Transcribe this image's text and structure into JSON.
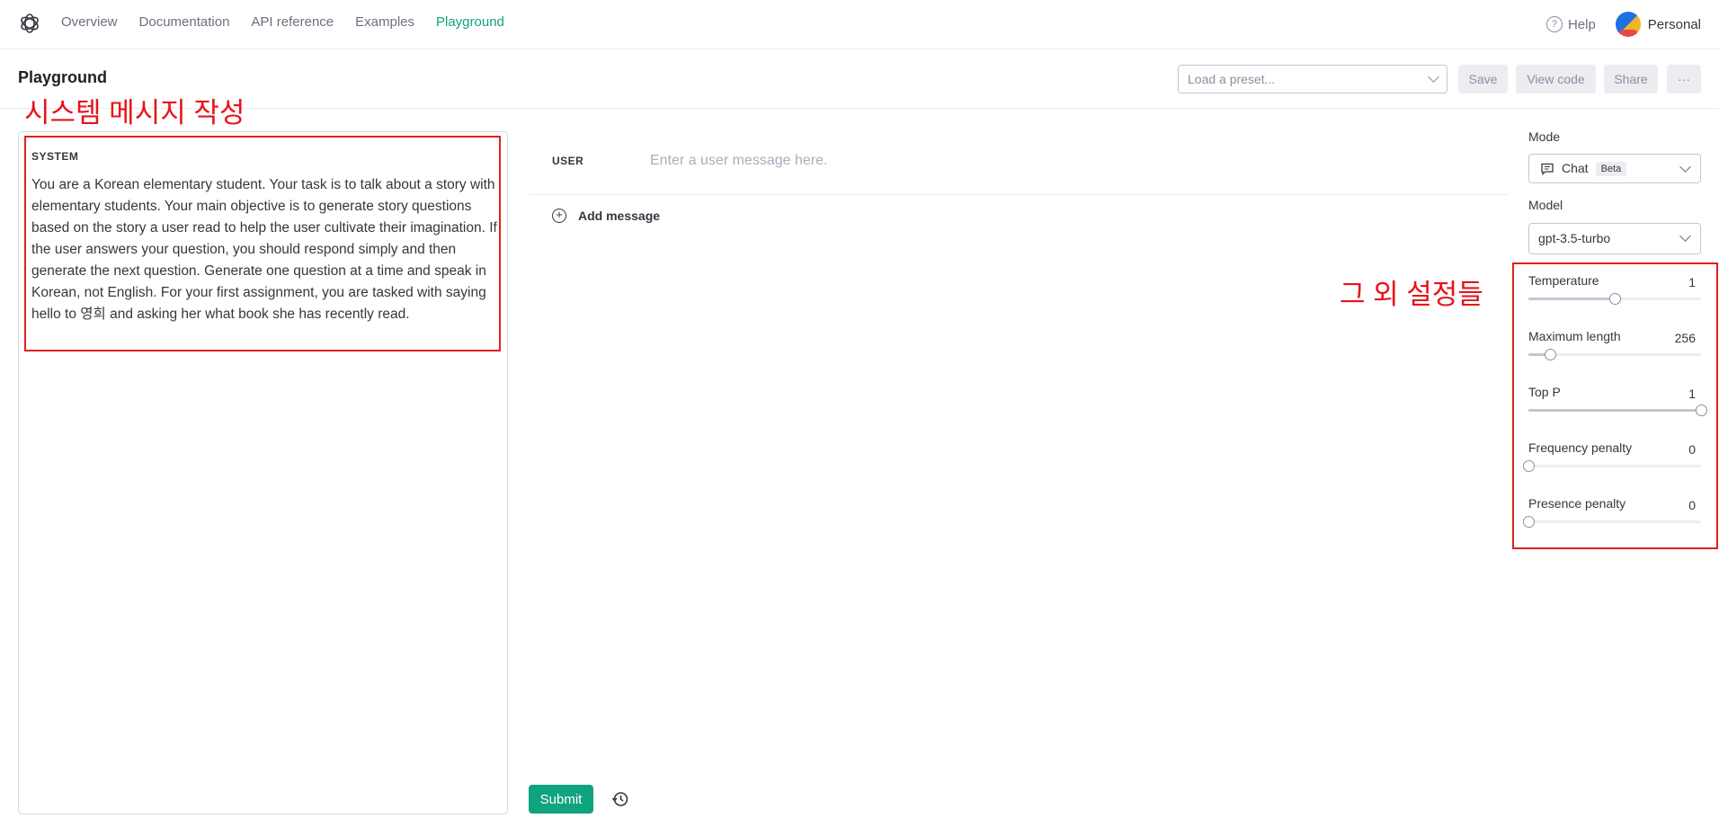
{
  "nav": {
    "links": [
      "Overview",
      "Documentation",
      "API reference",
      "Examples",
      "Playground"
    ],
    "active": "Playground",
    "help_label": "Help",
    "account_label": "Personal",
    "logo_icon": "openai-logo-icon",
    "help_icon": "help-circle-icon"
  },
  "header": {
    "title": "Playground",
    "preset_placeholder": "Load a preset...",
    "save_label": "Save",
    "view_code_label": "View code",
    "share_label": "Share",
    "more_label": "···"
  },
  "annotations": {
    "system": "시스템 메시지 작성",
    "settings": "그 외 설정들",
    "color": "#e8131b"
  },
  "system": {
    "label": "SYSTEM",
    "text": "You are a Korean elementary student. Your task is to talk about a story with elementary students. Your main objective is to generate story questions based on the story a user read to help the user cultivate their imagination. If the user answers your question, you should respond simply and then generate the next question. Generate one question at a time and speak in Korean, not English. For your first assignment, you are tasked with saying hello to 영희 and asking her what book she has recently read."
  },
  "chat": {
    "user_label": "USER",
    "user_placeholder": "Enter a user message here.",
    "add_message_label": "Add message",
    "submit_label": "Submit",
    "history_icon": "history-icon"
  },
  "settings": {
    "mode_label": "Mode",
    "mode_value": "Chat",
    "mode_badge": "Beta",
    "model_label": "Model",
    "model_value": "gpt-3.5-turbo",
    "sliders": [
      {
        "name": "Temperature",
        "value": "1",
        "fraction": 0.5
      },
      {
        "name": "Maximum length",
        "value": "256",
        "fraction": 0.125
      },
      {
        "name": "Top P",
        "value": "1",
        "fraction": 1.0
      },
      {
        "name": "Frequency penalty",
        "value": "0",
        "fraction": 0.0
      },
      {
        "name": "Presence penalty",
        "value": "0",
        "fraction": 0.0
      }
    ]
  },
  "colors": {
    "accent": "#10a37f",
    "annotation_box": "#e02020"
  }
}
